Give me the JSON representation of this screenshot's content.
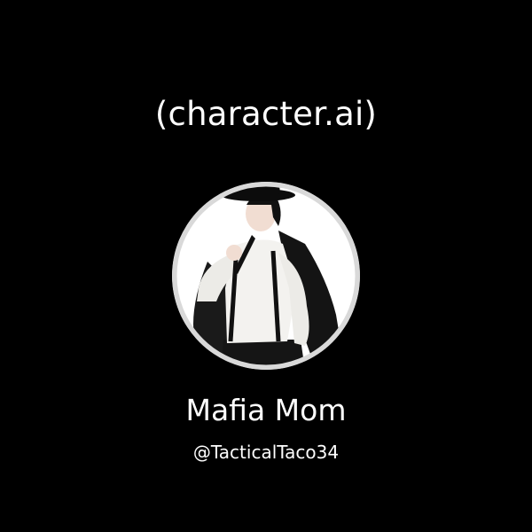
{
  "brand": {
    "label": "(character.ai)"
  },
  "character": {
    "name": "Mafia Mom",
    "handle": "@TacticalTaco34",
    "avatar_icon": "character-portrait"
  },
  "colors": {
    "background": "#000000",
    "text": "#ffffff",
    "avatar_ring": "#d9d9d9"
  }
}
